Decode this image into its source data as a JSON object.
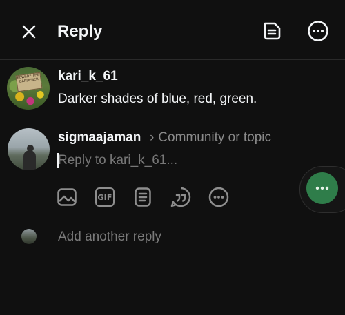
{
  "header": {
    "title": "Reply",
    "close_icon": "close-icon",
    "drafts_icon": "drafts-icon",
    "more_icon": "more-options-icon"
  },
  "original_post": {
    "username": "kari_k_61",
    "text": "Darker shades of blue, red, green.",
    "avatar_sign_text": "BEWARE THE GARDENER"
  },
  "composer": {
    "username": "sigmaajaman",
    "community_chevron": "›",
    "community_placeholder": "Community or topic",
    "reply_placeholder": "Reply to kari_k_61...",
    "reply_value": "",
    "tools": [
      {
        "name": "image-icon"
      },
      {
        "name": "gif-icon",
        "label": "GIF"
      },
      {
        "name": "poll-icon"
      },
      {
        "name": "quote-icon"
      },
      {
        "name": "more-icon"
      }
    ]
  },
  "add_another": {
    "label": "Add another reply"
  },
  "colors": {
    "background": "#101010",
    "text_primary": "#f3f5f7",
    "text_muted": "#7a7a7a",
    "bubble_green": "#2f7d4a"
  }
}
